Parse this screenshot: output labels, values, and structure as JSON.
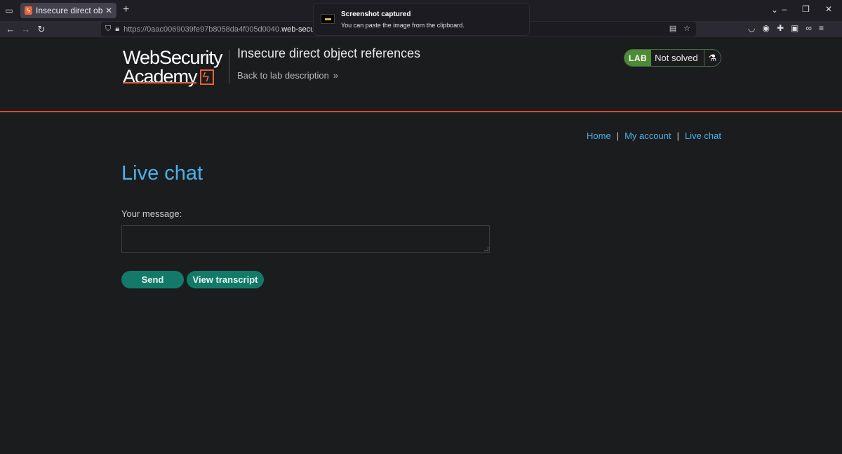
{
  "browser": {
    "tab_title": "Insecure direct object refe",
    "tab_close": "✕",
    "new_tab": "+",
    "url_prefix": "https://0aac0069039fe97b8058da4f005d0040.",
    "url_host": "web-security",
    "notification": {
      "title": "Screenshot captured",
      "body": "You can paste the image from the clipboard."
    }
  },
  "header": {
    "logo_line1": "WebSecurity",
    "logo_line2": "Academy",
    "lab_title": "Insecure direct object references",
    "back_link": "Back to lab description",
    "badge_label": "LAB",
    "badge_status": "Not solved"
  },
  "nav": {
    "home": "Home",
    "sep1": "|",
    "my_account": "My account",
    "sep2": "|",
    "live_chat": "Live chat"
  },
  "main": {
    "title": "Live chat",
    "message_label": "Your message:",
    "message_value": "",
    "send_label": "Send",
    "transcript_label": "View transcript"
  },
  "colors": {
    "accent_link": "#4cb0e8",
    "button_bg": "#137a6a",
    "header_rule": "#d64b1c",
    "lab_green": "#4d8b35"
  }
}
